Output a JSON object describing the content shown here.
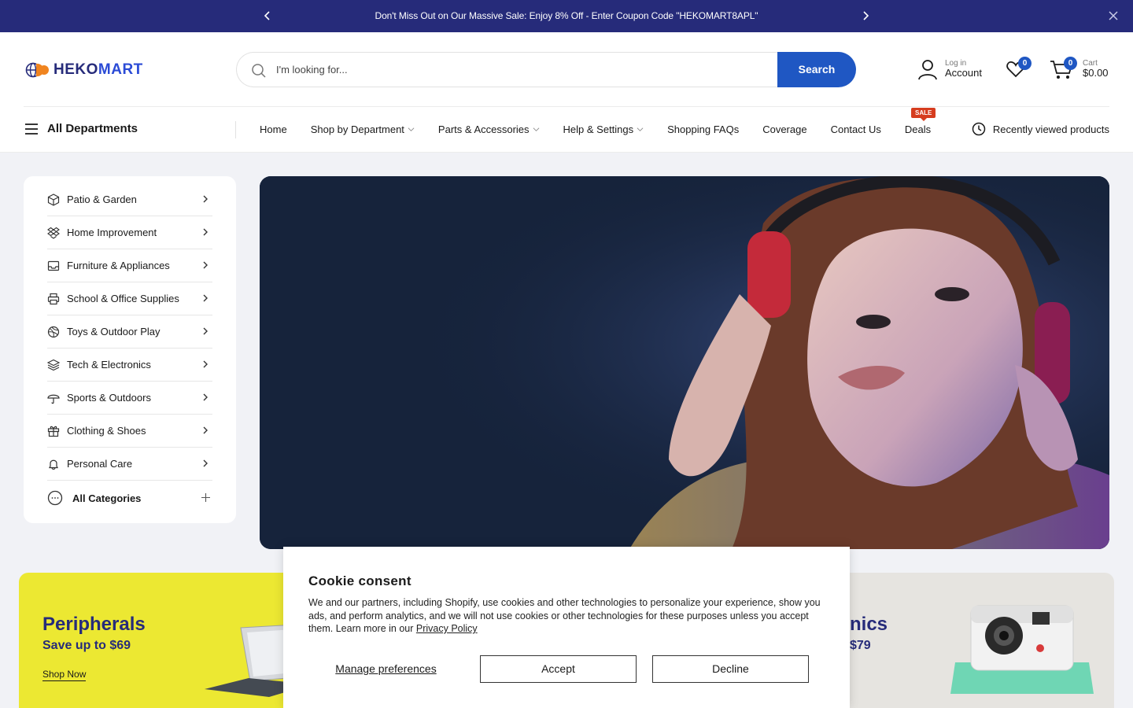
{
  "announcement": {
    "message": "Don't Miss Out on Our Massive Sale: Enjoy 8% Off - Enter Coupon Code \"HEKOMART8APL\""
  },
  "header": {
    "logo_text_a": "HEKO",
    "logo_text_b": "MART",
    "search_placeholder": "I'm looking for...",
    "search_button": "Search",
    "account_small": "Log in",
    "account_big": "Account",
    "wishlist_count": "0",
    "cart_count": "0",
    "cart_small": "Cart",
    "cart_total": "$0.00"
  },
  "nav": {
    "all_departments": "All Departments",
    "links": [
      {
        "label": "Home"
      },
      {
        "label": "Shop by Department"
      },
      {
        "label": "Parts & Accessories"
      },
      {
        "label": "Help & Settings"
      },
      {
        "label": "Shopping FAQs"
      },
      {
        "label": "Coverage"
      },
      {
        "label": "Contact Us"
      },
      {
        "label": "Deals"
      }
    ],
    "sale_badge": "SALE",
    "recently_viewed": "Recently viewed products"
  },
  "sidebar": {
    "items": [
      {
        "label": "Patio & Garden",
        "icon": "box-icon"
      },
      {
        "label": "Home Improvement",
        "icon": "dropbox-icon"
      },
      {
        "label": "Furniture & Appliances",
        "icon": "inbox-icon"
      },
      {
        "label": "School & Office Supplies",
        "icon": "printer-icon"
      },
      {
        "label": "Toys & Outdoor Play",
        "icon": "ball-icon"
      },
      {
        "label": "Tech & Electronics",
        "icon": "layers-icon"
      },
      {
        "label": "Sports & Outdoors",
        "icon": "umbrella-icon"
      },
      {
        "label": "Clothing & Shoes",
        "icon": "gift-icon"
      },
      {
        "label": "Personal Care",
        "icon": "bell-icon"
      }
    ],
    "all_categories": "All Categories"
  },
  "promos": {
    "left_title": "Peripherals",
    "left_sub": "Save up to $69",
    "left_link": "Shop Now",
    "right_title_partial": "nics",
    "right_sub_partial": "$79"
  },
  "cookie": {
    "title": "Cookie consent",
    "body": "We and our partners, including Shopify, use cookies and other technologies to personalize your experience, show you ads, and perform analytics, and we will not use cookies or other technologies for these purposes unless you accept them. Learn more in our ",
    "policy_link": "Privacy Policy",
    "manage": "Manage preferences",
    "accept": "Accept",
    "decline": "Decline"
  },
  "colors": {
    "brand_navy": "#262b7a",
    "brand_blue": "#1f57c3",
    "promo_yellow": "#ece832",
    "sale_red": "#d63d1f"
  }
}
